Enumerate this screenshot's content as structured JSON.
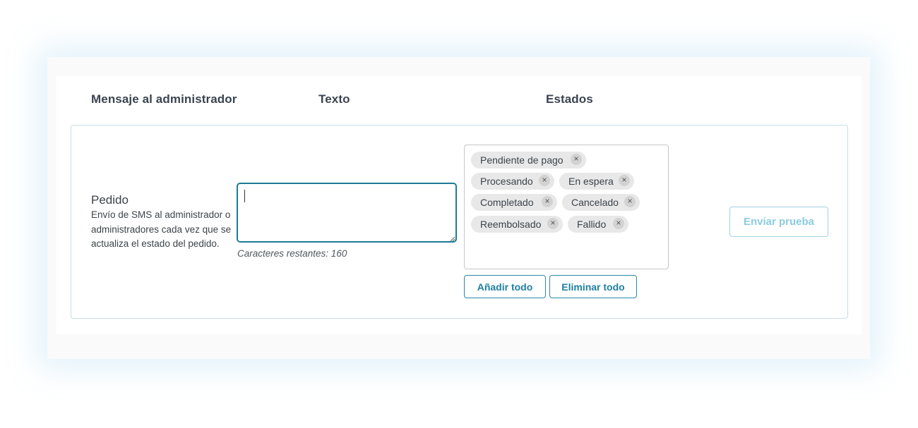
{
  "headers": {
    "admin_message": "Mensaje al administrador",
    "text": "Texto",
    "states": "Estados"
  },
  "row": {
    "title": "Pedido",
    "description": "Envío de SMS al administrador o administradores cada vez que se actualiza el estado del pedido.",
    "text_value": "",
    "counter": "Caracteres restantes: 160"
  },
  "tags": [
    "Pendiente de pago",
    "Procesando",
    "En espera",
    "Completado",
    "Cancelado",
    "Reembolsado",
    "Fallido"
  ],
  "remove_symbol": "×",
  "buttons": {
    "add_all": "Añadir todo",
    "remove_all": "Eliminar todo",
    "send_test": "Enviar prueba"
  },
  "colors": {
    "accent": "#1f7fa3",
    "focus_border": "#1e7a96",
    "tag_bg": "#e8e8e8",
    "disabled_button_text": "#8ccbe0"
  }
}
